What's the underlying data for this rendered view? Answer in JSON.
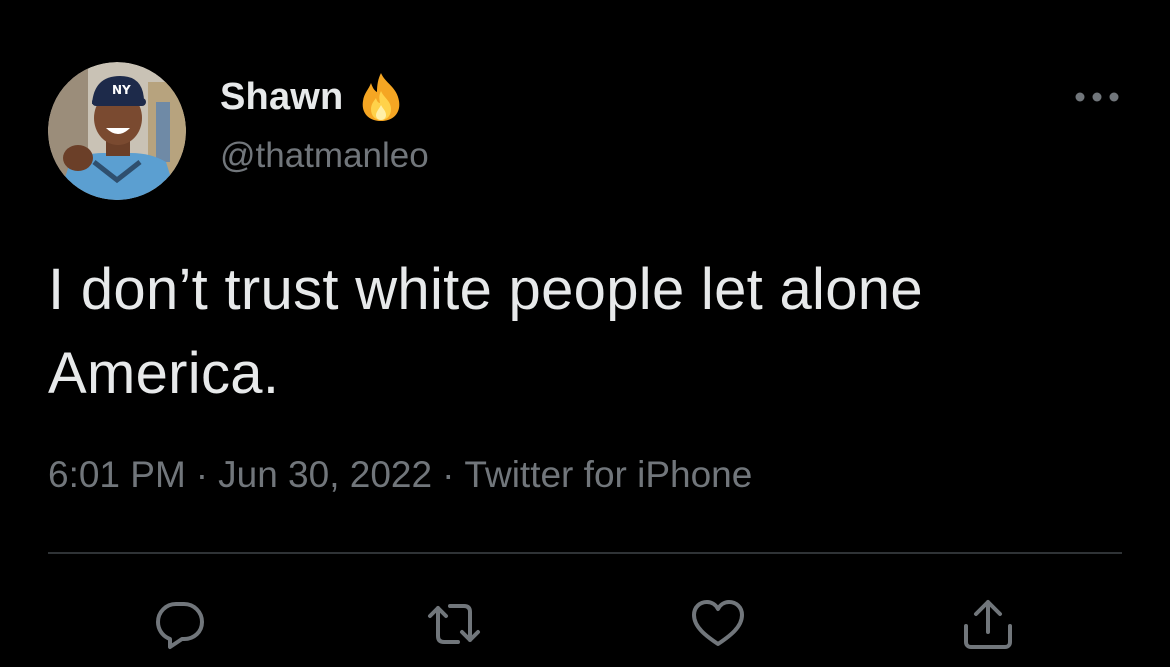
{
  "tweet": {
    "author": {
      "display_name": "Shawn",
      "name_emoji_icon": "fire-icon",
      "handle": "@thatmanleo",
      "avatar_icon": "profile-photo"
    },
    "text": "I don’t trust white people let alone America.",
    "meta": {
      "time": "6:01 PM",
      "separator": "·",
      "date": "Jun 30, 2022",
      "source": "Twitter for iPhone"
    },
    "actions": [
      {
        "icon": "reply-icon"
      },
      {
        "icon": "retweet-icon"
      },
      {
        "icon": "like-icon"
      },
      {
        "icon": "share-icon"
      }
    ],
    "more_icon": "more-options-icon"
  },
  "colors": {
    "background": "#000000",
    "primary_text": "#e7e9ea",
    "secondary_text": "#71767b",
    "divider": "#2f3336"
  }
}
